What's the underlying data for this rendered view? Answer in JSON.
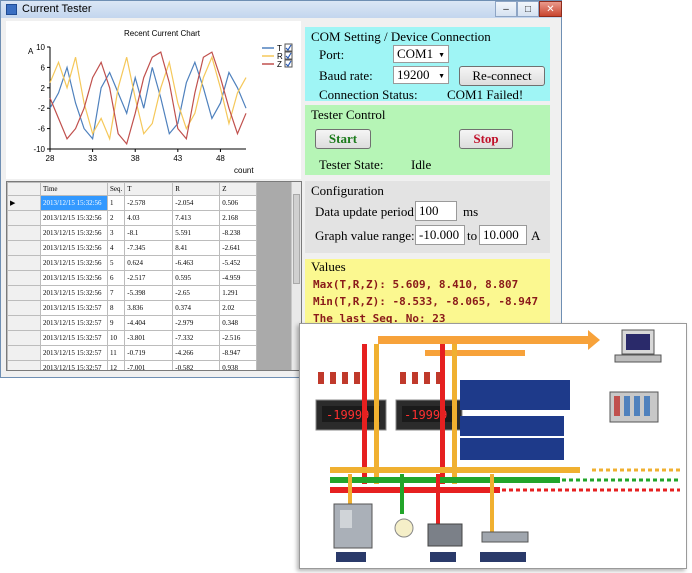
{
  "window": {
    "title": "Current Tester"
  },
  "chart": {
    "title": "Recent Current Chart",
    "y_unit": "A",
    "x_unit": "count",
    "legend": [
      {
        "name": "T",
        "checked": true,
        "color": "#4f81bd"
      },
      {
        "name": "R",
        "checked": true,
        "color": "#f5c85a"
      },
      {
        "name": "Z",
        "checked": true,
        "color": "#c0504d"
      }
    ]
  },
  "chart_data": {
    "type": "line",
    "title": "Recent Current Chart",
    "xlabel": "count",
    "ylabel": "A",
    "xlim": [
      28,
      51
    ],
    "ylim": [
      -10,
      10
    ],
    "x_ticks": [
      28,
      33,
      38,
      43,
      48
    ],
    "y_ticks": [
      10,
      6,
      2,
      -2,
      -6,
      -10
    ],
    "x": [
      28,
      29,
      30,
      31,
      32,
      33,
      34,
      35,
      36,
      37,
      38,
      39,
      40,
      41,
      42,
      43,
      44,
      45,
      46,
      47,
      48,
      49,
      50,
      51
    ],
    "series": [
      {
        "name": "T",
        "color": "#4f81bd",
        "values": [
          -2,
          1,
          6,
          -1,
          -6,
          -8,
          2,
          5,
          1,
          -3,
          4,
          -2,
          6,
          0,
          -7,
          -5,
          3,
          7,
          2,
          -4,
          -1,
          5,
          2,
          -2
        ]
      },
      {
        "name": "R",
        "color": "#f5c85a",
        "values": [
          3,
          7,
          2,
          8,
          -1,
          -7,
          -4,
          -8,
          2,
          8,
          0,
          -7,
          -5,
          2,
          7,
          -1,
          -6,
          -3,
          4,
          8,
          2,
          -5,
          1,
          4
        ]
      },
      {
        "name": "Z",
        "color": "#c0504d",
        "values": [
          0,
          -4,
          -8,
          -6,
          -2,
          4,
          7,
          2,
          -7,
          -9,
          -3,
          4,
          8,
          9,
          3,
          -6,
          -8,
          1,
          8,
          9,
          4,
          -2,
          -7,
          -3
        ]
      }
    ],
    "grid": false,
    "legend_position": "right"
  },
  "grid": {
    "columns": [
      "Time",
      "Seq.",
      "T",
      "R",
      "Z"
    ],
    "rows": [
      [
        "2013/12/15 15:32:56",
        "1",
        "-2.578",
        "-2.054",
        "0.506"
      ],
      [
        "2013/12/15 15:32:56",
        "2",
        "4.03",
        "7.413",
        "2.168"
      ],
      [
        "2013/12/15 15:32:56",
        "3",
        "-8.1",
        "5.591",
        "-8.238"
      ],
      [
        "2013/12/15 15:32:56",
        "4",
        "-7.345",
        "8.41",
        "-2.641"
      ],
      [
        "2013/12/15 15:32:56",
        "5",
        "0.624",
        "-6.463",
        "-5.452"
      ],
      [
        "2013/12/15 15:32:56",
        "6",
        "-2.517",
        "0.595",
        "-4.959"
      ],
      [
        "2013/12/15 15:32:56",
        "7",
        "-5.398",
        "-2.65",
        "1.291"
      ],
      [
        "2013/12/15 15:32:57",
        "8",
        "3.836",
        "0.374",
        "2.02"
      ],
      [
        "2013/12/15 15:32:57",
        "9",
        "-4.404",
        "-2.979",
        "0.348"
      ],
      [
        "2013/12/15 15:32:57",
        "10",
        "-3.801",
        "-7.332",
        "-2.516"
      ],
      [
        "2013/12/15 15:32:57",
        "11",
        "-0.719",
        "-4.266",
        "-8.947"
      ],
      [
        "2013/12/15 15:32:57",
        "12",
        "-7.001",
        "-0.582",
        "0.938"
      ]
    ]
  },
  "com": {
    "title": "COM Setting / Device Connection",
    "port_label": "Port:",
    "port_value": "COM1",
    "baud_label": "Baud rate:",
    "baud_value": "19200",
    "reconnect_label": "Re-connect",
    "status_label": "Connection Status:",
    "status_value": "COM1 Failed!"
  },
  "tester": {
    "title": "Tester Control",
    "start_label": "Start",
    "stop_label": "Stop",
    "state_label": "Tester State:",
    "state_value": "Idle",
    "start_color": "#1a7a1a",
    "stop_color": "#c0102a"
  },
  "config": {
    "title": "Configuration",
    "period_label": "Data update period:",
    "period_value": "100",
    "period_unit": "ms",
    "range_label": "Graph value range:",
    "range_min": "-10.000",
    "range_to": "to",
    "range_max": "10.000",
    "range_unit": "A"
  },
  "values": {
    "title": "Values",
    "max_line": "Max(T,R,Z):  5.609, 8.410, 8.807",
    "min_line": "Min(T,R,Z):  -8.533, -8.065, -8.947",
    "seq_line": "The last Seq. No:  23"
  },
  "diagram": {
    "meter_readings": [
      "-19999",
      "-19999"
    ]
  }
}
